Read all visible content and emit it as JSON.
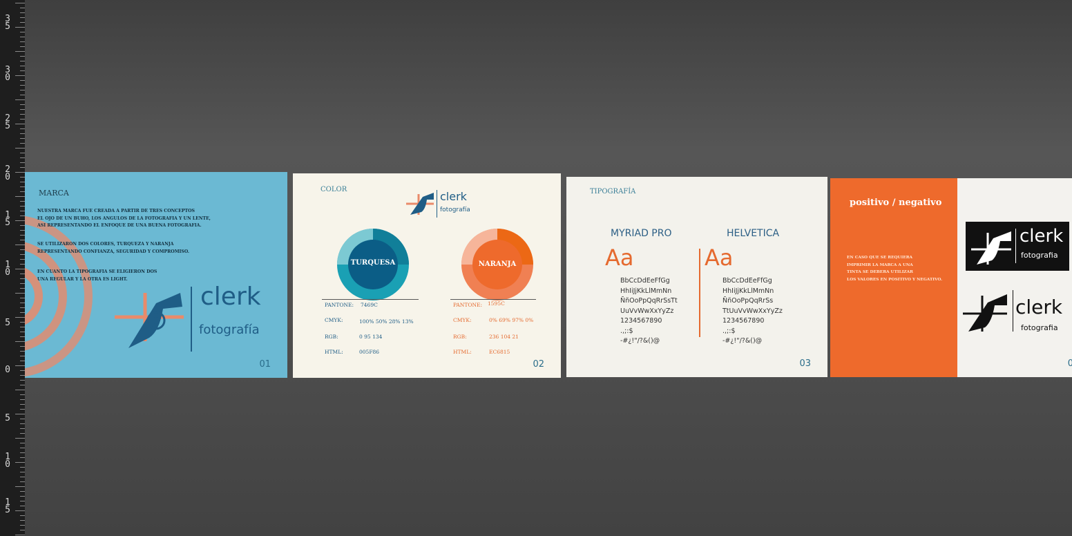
{
  "ruler": {
    "labels": [
      "3\n5",
      "3\n0",
      "2\n5",
      "2\n0",
      "1\n5",
      "1\n0",
      "5",
      "0",
      "5",
      "1\n0",
      "1\n5"
    ]
  },
  "board1": {
    "title": "MARCA",
    "para1": [
      "NUESTRA MARCA FUE CREADA A PARTIR DE TRES CONCEPTOS",
      "EL OJO DE UN BUHO, LOS ANGULOS DE LA FOTOGRAFIA Y UN LENTE,",
      "ASI REPRESENTANDO EL ENFOQUE DE UNA BUENA FOTOGRAFIA."
    ],
    "para2": [
      "SE UTILIZARON DOS COLORES, TURQUEZA Y NARANJA",
      "REPRESENTANDO CONFIANZA, SEGURIDAD Y COMPROMISO."
    ],
    "para3": [
      "EN CUANTO LA TIPOGRAFIA SE ELIGIERON DOS",
      "UNA REGULAR Y LA OTRA ES LIGHT."
    ],
    "logo_word": "clerk",
    "logo_sub": "fotografía",
    "number": "01",
    "colors": {
      "bg": "#6bb9d3",
      "accent": "#e98a6a",
      "logo": "#1f5d86"
    }
  },
  "board2": {
    "title": "COLOR",
    "logo_word": "clerk",
    "logo_sub": "fotografía",
    "left": {
      "name": "TURQUESA",
      "labels": [
        "PANTONE:",
        "CMYK:",
        "RGB:",
        "HTML:"
      ],
      "values": [
        "7469C",
        "100%  50%  28%  13%",
        "0  95  134",
        "005F86"
      ],
      "color": "#005f86"
    },
    "right": {
      "name": "NARANJA",
      "labels": [
        "PANTONE:",
        "CMYK:",
        "RGB:",
        "HTML:"
      ],
      "values": [
        "1595C",
        "0%  69%  97%  0%",
        "236  104  21",
        "EC6815"
      ],
      "color": "#ec6815"
    },
    "number": "02"
  },
  "board3": {
    "title": "TIPOGRAFÍA",
    "font1": "MYRIAD PRO",
    "font2": "HELVETICA",
    "aa": "Aa",
    "glyphs1": [
      "BbCcDdEeFfGg",
      "HhIiJjKkLlMmNn",
      "ÑñOoPpQqRrSsTt",
      "UuVvWwXxYyZz",
      "1234567890",
      ".,;:$",
      "-#¿!\"/?&()@"
    ],
    "glyphs2": [
      "BbCcDdEeFfGg",
      "HhIiJjKkLlMmNn",
      "ÑñOoPpQqRrSs",
      "TtUuVvWwXxYyZz",
      "1234567890",
      ".,;:$",
      "-#¿!\"/?&()@"
    ],
    "number": "03"
  },
  "board4": {
    "title": "positivo / negativo",
    "para": [
      "EN CASO QUE SE REQUIERA",
      "IMPRIMIR LA MARCA A UNA",
      "TINTA SE DEBERA UTILIZAR",
      "LOS VALORES EN POSITIVO Y NEGATIVO."
    ],
    "logo_word": "clerk",
    "logo_sub": "fotografia",
    "number": "0"
  }
}
